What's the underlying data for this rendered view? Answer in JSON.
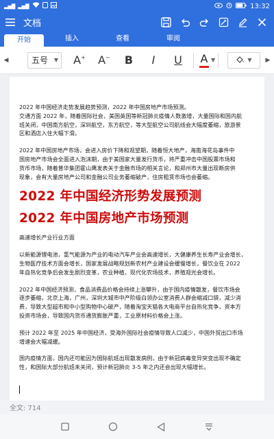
{
  "status": {
    "time": "13:32",
    "battery": "68"
  },
  "app": {
    "title": "文档"
  },
  "tabs": [
    "开始",
    "插入",
    "查看",
    "审阅"
  ],
  "ribbon": {
    "font_size": "五号",
    "grow_label": "A",
    "shrink_label": "A",
    "bold_label": "B",
    "italic_label": "I",
    "underline_label": "U",
    "font_color_label": "A",
    "font_color": "#e02020"
  },
  "document": {
    "para1": [
      "2022 年中国经济走势发展趋势预测，2022 年中国房地产市场预测。",
      "交通方面 2022 年，随着国际社会，美国英国等新冠肺炎疫情人数激增，大量国际和国内航",
      "班关闭，中国南方航空，深圳航空，东方航空，等大型航空公司航线会大幅度萎缩，旅游景",
      "区和酒店入住大幅下滑。"
    ],
    "para2": [
      "2022 年中国房地产市场，会进入房价下降和观望期，随着恒大地产，海南海花岛事件中",
      "国房地产市场会全面进入泡沫期，由于美国家大量发行货币，将严重冲击中国股票市场和",
      "货币市场，随着普华集团霍山鹰发表关于金融市场的相关言论，和郑州市大量出现断房供",
      "现象，会有大量房地产公司和金融公司业务萎缩破产，住房租赁市场也会萎缩。"
    ],
    "heading1": "2022 年中国经济形势发展预测",
    "heading2": "2022 年中国房地产市场预测",
    "para3": [
      "高速增长产业行业方面"
    ],
    "para4": [
      "以新能源锂电池，氢气能源为产业的电动汽车产业会高速增长，大健康养生长寿产业会增长，",
      "生物医疗技术方面会增长，国家发展战略规划新农村产业建设会缓慢增长，餐饮业在 2022",
      "年自热化竞争后会发生剧烈变革，农业种植，现代化农场技术，养殖观光会增长。"
    ],
    "para5": [
      "2022 年中国经济预测，食品消费品价格会持续上涨攀升，由于国内疫情散发，餐饮市场会",
      "逐步萎缩，北京上海，广州，深圳大城市中产阶级白领办公室消费人群会缩减口袋，减少消",
      "费，导致大型超市和中小型购物中心破产，随着淘宝天猫各大电商平台自热化竞争，资本方",
      "投资市场会，导致国内货币通货膨胀严重，工业原材料价格会上涨。"
    ],
    "para6": [
      "预计 2022 年至 2025 年中国经济，受海外国际社会疫情导致人口减少，中国外贸出口市场",
      "增速会大幅减缓。"
    ],
    "para7": [
      "国内疫情方面，国内还可能因为国际航班出现散发病例，由于新冠病毒变异突变出现不确定",
      "性，和国际大部分航班未关闭，预计新冠肺炎 3-5 年之内还会出现大幅增长。"
    ]
  },
  "word_count": "全文: 714",
  "colors": {
    "accent": "#2f6fde",
    "heading": "#cc0b0b"
  }
}
